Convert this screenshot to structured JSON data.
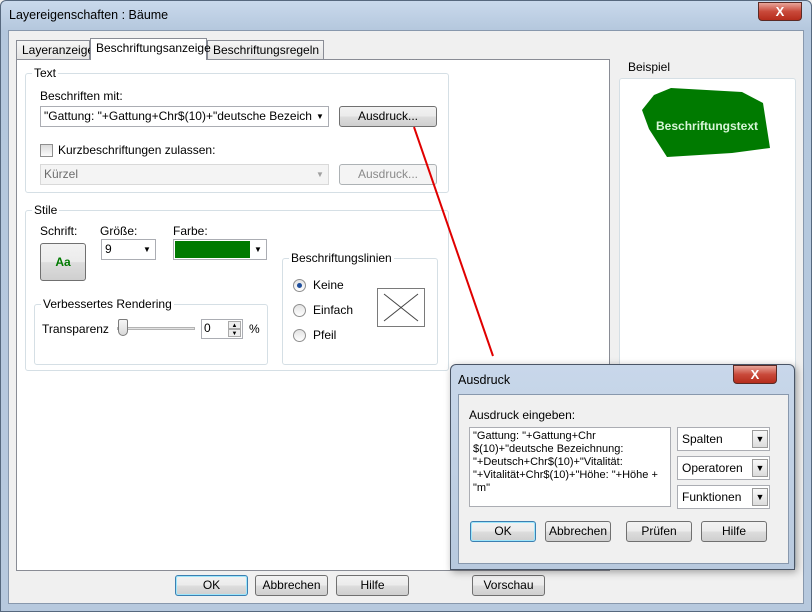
{
  "window": {
    "title": "Layereigenschaften  : Bäume",
    "close_glyph": "X"
  },
  "tabs": [
    "Layeranzeige",
    "Beschriftungsanzeige",
    "Beschriftungsregeln"
  ],
  "text_group": {
    "title": "Text",
    "label_with": "Beschriften mit:",
    "expression_value": "\"Gattung: \"+Gattung+Chr$(10)+\"deutsche Bezeichnung",
    "expression_button": "Ausdruck...",
    "short_labels_checkbox": "Kurzbeschriftungen zulassen:",
    "short_value": "Kürzel",
    "short_button": "Ausdruck..."
  },
  "styles_group": {
    "title": "Stile",
    "font_label": "Schrift:",
    "font_button": "Aa",
    "size_label": "Größe:",
    "size_value": "9",
    "color_label": "Farbe:",
    "color_value": "#007a00"
  },
  "rendering_group": {
    "title": "Verbessertes Rendering",
    "transparency_label": "Transparenz",
    "transparency_value": "0",
    "percent": "%"
  },
  "leader_group": {
    "title": "Beschriftungslinien",
    "options": [
      "Keine",
      "Einfach",
      "Pfeil"
    ],
    "selected": "Keine"
  },
  "example": {
    "title": "Beispiel",
    "sample_text": "Beschriftungstext",
    "fill": "#007a00",
    "text_color": "#d8f5d8"
  },
  "bottom_buttons": {
    "ok": "OK",
    "cancel": "Abbrechen",
    "help": "Hilfe",
    "preview": "Vorschau"
  },
  "expr_dialog": {
    "title": "Ausdruck",
    "close_glyph": "X",
    "prompt": "Ausdruck eingeben:",
    "expression": "\"Gattung: \"+Gattung+Chr\n$(10)+\"deutsche Bezeichnung:\n\"+Deutsch+Chr$(10)+\"Vitalität:\n\"+Vitalität+Chr$(10)+\"Höhe: \"+Höhe +\n\"m\"",
    "dropdowns": [
      "Spalten",
      "Operatoren",
      "Funktionen"
    ],
    "buttons": {
      "ok": "OK",
      "cancel": "Abbrechen",
      "check": "Prüfen",
      "help": "Hilfe"
    }
  }
}
